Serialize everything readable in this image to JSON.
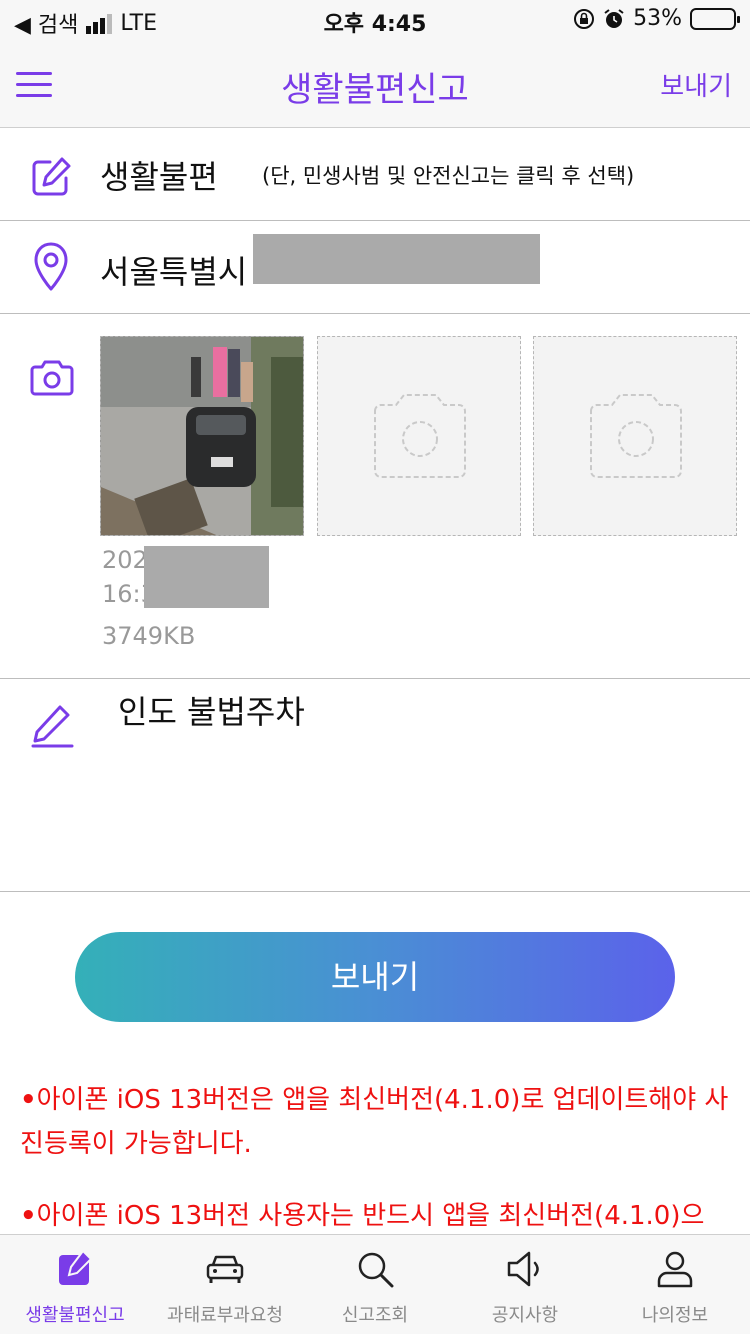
{
  "status_bar": {
    "back_label": "◀ 검색",
    "network": "LTE",
    "time": "오후 4:45",
    "battery": "53%"
  },
  "header": {
    "title": "생활불편신고",
    "send_label": "보내기"
  },
  "category": {
    "label": "생활불편",
    "note": "(단, 민생사범 및 안전신고는 클릭 후 선택)"
  },
  "location": {
    "label": "서울특별시"
  },
  "photos": {
    "meta_date": "202",
    "meta_time": "16:3",
    "meta_size": "3749KB"
  },
  "description": {
    "text": "인도 불법주차"
  },
  "send_button": {
    "label": "보내기"
  },
  "notices": [
    {
      "bullet": "•",
      "text": "아이폰 iOS 13버전은 앱을 최신버전(4.1.0)로 업데이트해야 사진등록이 가능합니다."
    },
    {
      "bullet": "•",
      "text": "아이폰 iOS 13버전 사용자는 반드시 앱을 최신버전(4.1.0)으"
    }
  ],
  "tabs": [
    {
      "label": "생활불편신고",
      "icon": "edit-square-icon",
      "active": true
    },
    {
      "label": "과태료부과요청",
      "icon": "car-icon",
      "active": false
    },
    {
      "label": "신고조회",
      "icon": "search-icon",
      "active": false
    },
    {
      "label": "공지사항",
      "icon": "speaker-icon",
      "active": false
    },
    {
      "label": "나의정보",
      "icon": "user-icon",
      "active": false
    }
  ],
  "colors": {
    "accent": "#7a3ce8",
    "notice": "#ee1111",
    "button_gradient_start": "#34b0b8",
    "button_gradient_end": "#5b62ea"
  }
}
